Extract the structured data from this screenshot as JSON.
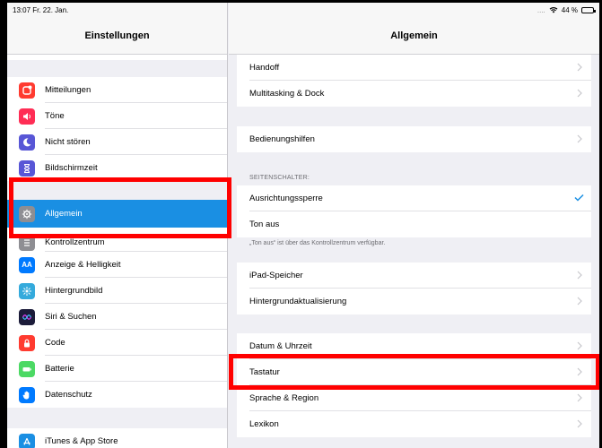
{
  "status": {
    "time_date": "13:07  Fr. 22. Jan.",
    "signal": "....",
    "battery": "44 %",
    "battery_level": 0.44
  },
  "left": {
    "title": "Einstellungen",
    "items": [
      {
        "label": "Mitteilungen",
        "icon": "notifications-icon",
        "color": "#ff3b30"
      },
      {
        "label": "Töne",
        "icon": "sounds-icon",
        "color": "#ff2d55"
      },
      {
        "label": "Nicht stören",
        "icon": "moon-icon",
        "color": "#5856d6"
      },
      {
        "label": "Bildschirmzeit",
        "icon": "hourglass-icon",
        "color": "#5856d6"
      },
      {
        "label": "Allgemein",
        "icon": "gear-icon",
        "color": "#8e8e93"
      },
      {
        "label": "Kontrollzentrum",
        "icon": "control-center-icon",
        "color": "#8e8e93"
      },
      {
        "label": "Anzeige & Helligkeit",
        "icon": "display-icon",
        "color": "#007aff"
      },
      {
        "label": "Hintergrundbild",
        "icon": "wallpaper-icon",
        "color": "#34aadc"
      },
      {
        "label": "Siri & Suchen",
        "icon": "siri-icon",
        "color": "#1c1c3a"
      },
      {
        "label": "Code",
        "icon": "lock-icon",
        "color": "#ff3b30"
      },
      {
        "label": "Batterie",
        "icon": "battery-icon",
        "color": "#4cd964"
      },
      {
        "label": "Datenschutz",
        "icon": "hand-icon",
        "color": "#007aff"
      },
      {
        "label": "iTunes & App Store",
        "icon": "app-store-icon",
        "color": "#1a8fe3"
      }
    ]
  },
  "right": {
    "title": "Allgemein",
    "handoff": "Handoff",
    "multitasking": "Multitasking & Dock",
    "accessibility": "Bedienungshilfen",
    "side_switch_label": "SEITENSCHALTER:",
    "orientation_lock": "Ausrichtungssperre",
    "mute": "Ton aus",
    "footnote": "„Ton aus“ ist über das Kontrollzentrum verfügbar.",
    "storage": "iPad-Speicher",
    "background_refresh": "Hintergrundaktualisierung",
    "date_time": "Datum & Uhrzeit",
    "keyboard": "Tastatur",
    "language_region": "Sprache & Region",
    "dictionary": "Lexikon"
  },
  "colors": {
    "accent": "#1a8fe3",
    "highlight": "#ff0000"
  }
}
